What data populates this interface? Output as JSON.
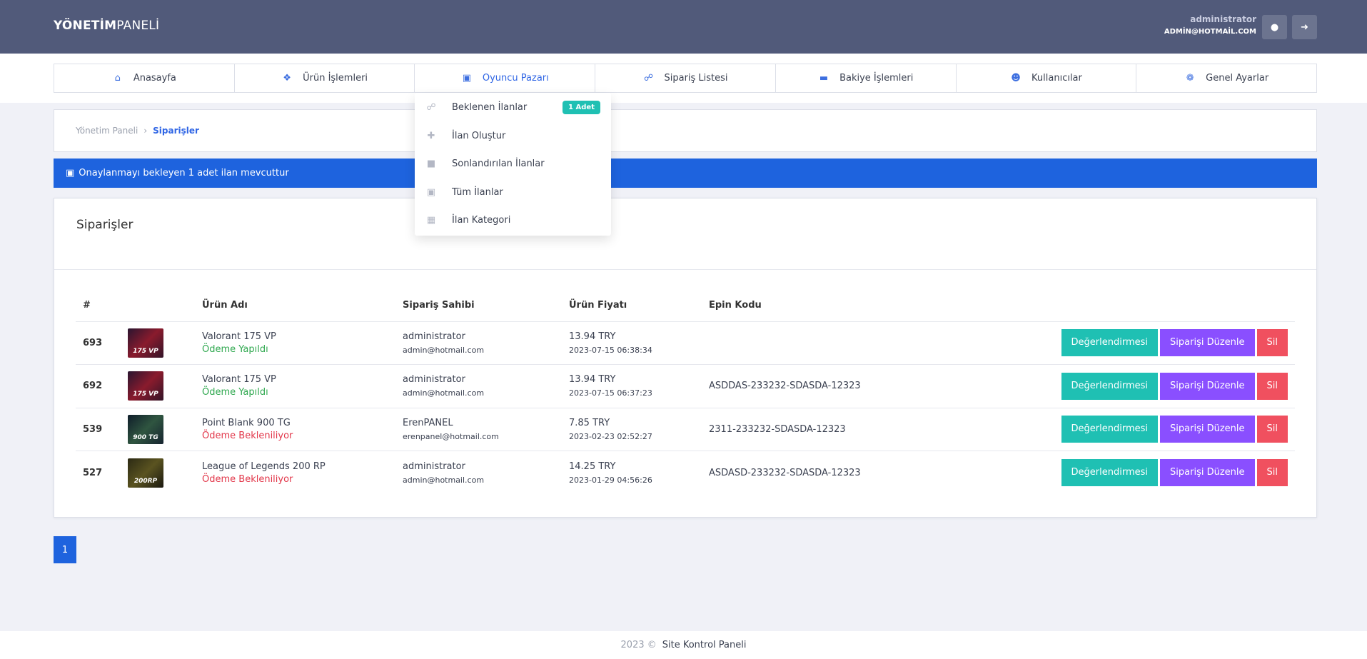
{
  "header": {
    "brand_bold": "YÖNETİM",
    "brand_light": "PANELİ",
    "user_name": "administrator",
    "user_email": "ADMİN@HOTMAİL.COM"
  },
  "nav": {
    "items": [
      {
        "label": "Anasayfa",
        "icon": "home-icon"
      },
      {
        "label": "Ürün İşlemleri",
        "icon": "tags-icon"
      },
      {
        "label": "Oyuncu Pazarı",
        "icon": "store-icon"
      },
      {
        "label": "Sipariş Listesi",
        "icon": "cart-icon"
      },
      {
        "label": "Bakiye İşlemleri",
        "icon": "credit-card-icon"
      },
      {
        "label": "Kullanıcılar",
        "icon": "users-icon"
      },
      {
        "label": "Genel Ayarlar",
        "icon": "gear-icon"
      }
    ]
  },
  "dropdown": {
    "items": [
      {
        "label": "Beklenen İlanlar",
        "badge": "1 Adet"
      },
      {
        "label": "İlan Oluştur"
      },
      {
        "label": "Sonlandırılan İlanlar"
      },
      {
        "label": "Tüm İlanlar"
      },
      {
        "label": "İlan Kategori"
      }
    ]
  },
  "breadcrumb": {
    "home": "Yönetim Paneli",
    "current": "Siparişler"
  },
  "alert": {
    "text": "Onaylanmayı bekleyen 1 adet ilan mevcuttur"
  },
  "orders": {
    "title": "Siparişler",
    "columns": [
      "#",
      "",
      "Ürün Adı",
      "Sipariş Sahibi",
      "Ürün Fiyatı",
      "Epin Kodu",
      ""
    ],
    "rows": [
      {
        "id": "693",
        "thumb": "175 VP",
        "product": "Valorant 175 VP",
        "status": "Ödeme Yapıldı",
        "owner": "administrator",
        "email": "admin@hotmail.com",
        "price": "13.94 TRY",
        "date": "2023-07-15 06:38:34",
        "epin": ""
      },
      {
        "id": "692",
        "thumb": "175 VP",
        "product": "Valorant 175 VP",
        "status": "Ödeme Yapıldı",
        "owner": "administrator",
        "email": "admin@hotmail.com",
        "price": "13.94 TRY",
        "date": "2023-07-15 06:37:23",
        "epin": "ASDDAS-233232-SDASDA-12323"
      },
      {
        "id": "539",
        "thumb": "900 TG",
        "product": "Point Blank 900 TG",
        "status": "Ödeme Bekleniliyor",
        "owner": "ErenPANEL",
        "email": "erenpanel@hotmail.com",
        "price": "7.85 TRY",
        "date": "2023-02-23 02:52:27",
        "epin": "2311-233232-SDASDA-12323"
      },
      {
        "id": "527",
        "thumb": "200RP",
        "product": "League of Legends 200 RP",
        "status": "Ödeme Bekleniliyor",
        "owner": "administrator",
        "email": "admin@hotmail.com",
        "price": "14.25 TRY",
        "date": "2023-01-29 04:56:26",
        "epin": "ASDASD-233232-SDASDA-12323"
      }
    ],
    "actions": {
      "review": "Değerlendirmesi",
      "edit": "Siparişi Düzenle",
      "delete": "Sil"
    }
  },
  "pagination": {
    "current": "1"
  },
  "footer": {
    "year": "2023 ©",
    "site": "Site Kontrol Paneli"
  },
  "colors": {
    "header": "#515a7a",
    "primary": "#1e63de",
    "teal": "#1fc0b3",
    "purple": "#8a4fff",
    "red": "#f0505f"
  }
}
